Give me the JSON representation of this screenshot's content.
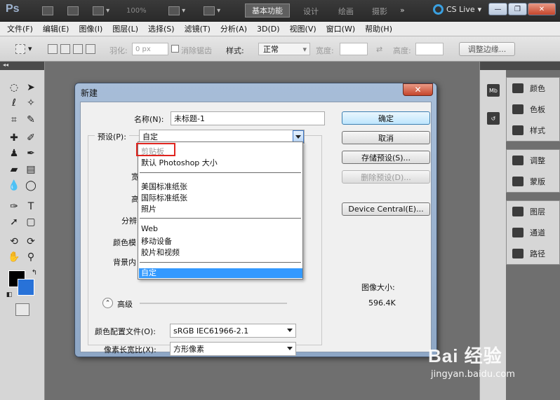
{
  "app": {
    "logo": "Ps",
    "zoom": "100%",
    "workspace_active": "基本功能",
    "workspaces": [
      "设计",
      "绘画",
      "摄影"
    ],
    "more": "»",
    "cs_live": "CS Live",
    "window_buttons": [
      "—",
      "❐",
      "✕"
    ]
  },
  "menubar": {
    "items": [
      "文件(F)",
      "编辑(E)",
      "图像(I)",
      "图层(L)",
      "选择(S)",
      "滤镜(T)",
      "分析(A)",
      "3D(D)",
      "视图(V)",
      "窗口(W)",
      "帮助(H)"
    ]
  },
  "options_bar": {
    "feather_label": "羽化:",
    "feather_value": "0 px",
    "antialias_label": "消除锯齿",
    "style_label": "样式:",
    "style_value": "正常",
    "width_label": "宽度:",
    "height_label": "高度:",
    "refine_button": "调整边缘..."
  },
  "right_panels": {
    "group1": [
      "颜色",
      "色板",
      "样式"
    ],
    "group2": [
      "调整",
      "蒙版"
    ],
    "group3": [
      "图层",
      "通道",
      "路径"
    ]
  },
  "dialog": {
    "title": "新建",
    "close": "✕",
    "name_label": "名称(N):",
    "name_value": "未标题-1",
    "preset_label": "预设(P):",
    "preset_value": "自定",
    "partial_labels": [
      "宽",
      "高",
      "分辨",
      "颜色模",
      "背景内"
    ],
    "advanced_label": "高级",
    "color_profile_label": "颜色配置文件(O):",
    "color_profile_value": "sRGB IEC61966-2.1",
    "pixel_aspect_label": "像素长宽比(X):",
    "pixel_aspect_value": "方形像素",
    "buttons": {
      "ok": "确定",
      "cancel": "取消",
      "save_preset": "存储预设(S)...",
      "delete_preset": "删除预设(D)...",
      "device_central": "Device Central(E)..."
    },
    "image_size_label": "图像大小:",
    "image_size_value": "596.4K"
  },
  "preset_dropdown": {
    "items": [
      "剪贴板",
      "默认 Photoshop 大小",
      "美国标准纸张",
      "国际标准纸张",
      "照片",
      "Web",
      "移动设备",
      "胶片和视频",
      "自定"
    ],
    "selected": "自定"
  },
  "watermark": {
    "brand": "Bai 经验",
    "url": "jingyan.baidu.com"
  },
  "colors": {
    "foreground": "#000000",
    "background": "#2872d8",
    "selection": "#3399ff",
    "highlight": "#e0251f"
  }
}
